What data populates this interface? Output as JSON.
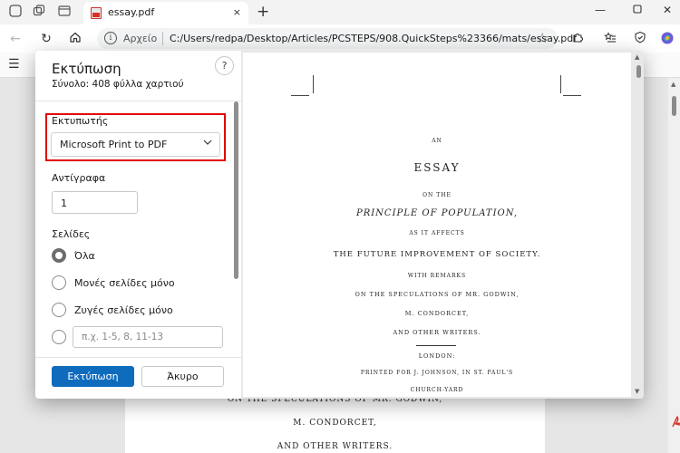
{
  "browser": {
    "tab_title": "essay.pdf",
    "tab_close_icon": "×",
    "new_tab_icon": "+",
    "address_scheme": "Αρχείο",
    "address_url": "C:/Users/redpa/Desktop/Articles/PCSTEPS/908.QuickSteps%23366/mats/essay.pdf"
  },
  "print_dialog": {
    "title": "Εκτύπωση",
    "subtitle": "Σύνολο: 408 φύλλα χαρτιού",
    "help_label": "?",
    "printer": {
      "label": "Εκτυπωτής",
      "selected": "Microsoft Print to PDF",
      "highlight_color": "#e00000"
    },
    "copies": {
      "label": "Αντίγραφα",
      "value": "1"
    },
    "pages": {
      "label": "Σελίδες",
      "options": [
        {
          "label": "Όλα",
          "checked": true
        },
        {
          "label": "Μονές σελίδες μόνο",
          "checked": false
        },
        {
          "label": "Ζυγές σελίδες μόνο",
          "checked": false
        }
      ],
      "range_placeholder": "π.χ. 1-5, 8, 11-13"
    },
    "print_button": "Εκτύπωση",
    "cancel_button": "Άκυρο",
    "accent_color": "#0f6cbd"
  },
  "preview": {
    "lines": [
      "AN",
      "ESSAY",
      "ON THE",
      "PRINCIPLE OF POPULATION,",
      "AS IT AFFECTS",
      "THE FUTURE IMPROVEMENT OF SOCIETY.",
      "WITH REMARKS",
      "ON THE SPECULATIONS OF MR. GODWIN,",
      "M. CONDORCET,",
      "AND OTHER WRITERS.",
      "LONDON:",
      "PRINTED FOR J. JOHNSON, IN ST. PAUL'S",
      "CHURCH-YARD"
    ]
  },
  "background_page": {
    "lines": [
      "ON THE SPECULATIONS OF MR. GODWIN,",
      "M. CONDORCET,",
      "AND OTHER WRITERS."
    ]
  }
}
